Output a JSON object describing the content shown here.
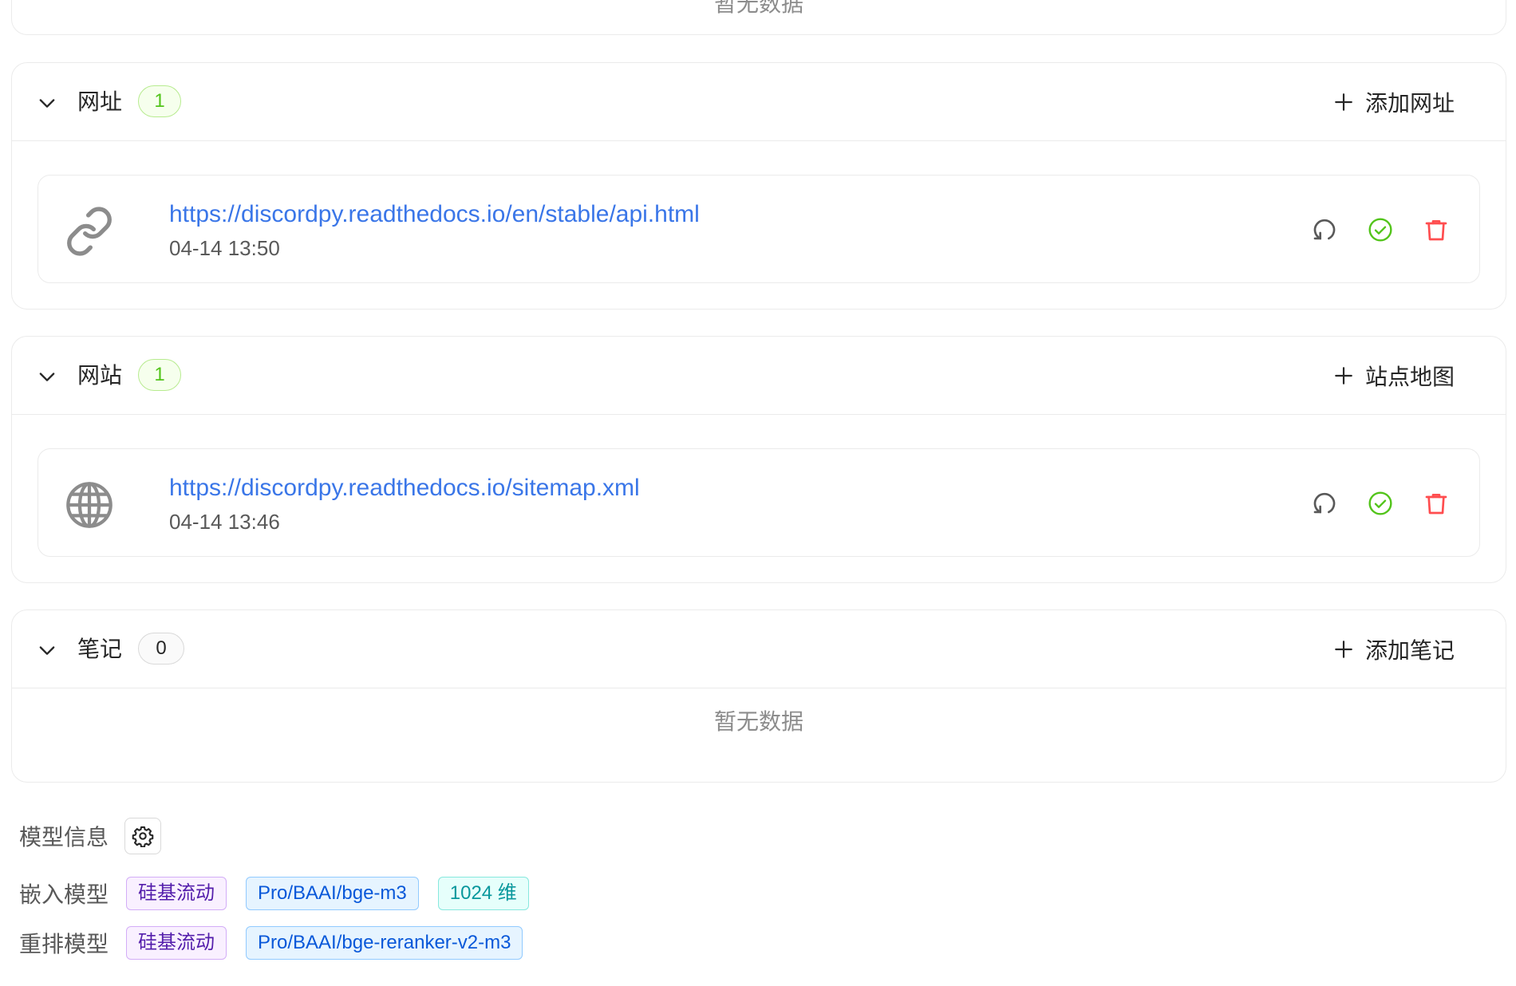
{
  "top_empty_partial": "暂无数据",
  "sections": [
    {
      "title": "网址",
      "count": "1",
      "add_label": "添加网址",
      "items": [
        {
          "url": "https://discordpy.readthedocs.io/en/stable/api.html",
          "time": "04-14 13:50",
          "icon": "link-icon"
        }
      ]
    },
    {
      "title": "网站",
      "count": "1",
      "add_label": "站点地图",
      "items": [
        {
          "url": "https://discordpy.readthedocs.io/sitemap.xml",
          "time": "04-14 13:46",
          "icon": "globe-icon"
        }
      ]
    },
    {
      "title": "笔记",
      "count": "0",
      "add_label": "添加笔记",
      "empty_text": "暂无数据"
    }
  ],
  "model_info": {
    "label": "模型信息",
    "embedding": {
      "label": "嵌入模型",
      "provider": "硅基流动",
      "model": "Pro/BAAI/bge-m3",
      "dimensions": "1024 维"
    },
    "rerank": {
      "label": "重排模型",
      "provider": "硅基流动",
      "model": "Pro/BAAI/bge-reranker-v2-m3"
    }
  },
  "colors": {
    "link": "#3a76e8",
    "success": "#52c41a",
    "danger": "#ff4d4f",
    "border": "#ebebeb"
  }
}
